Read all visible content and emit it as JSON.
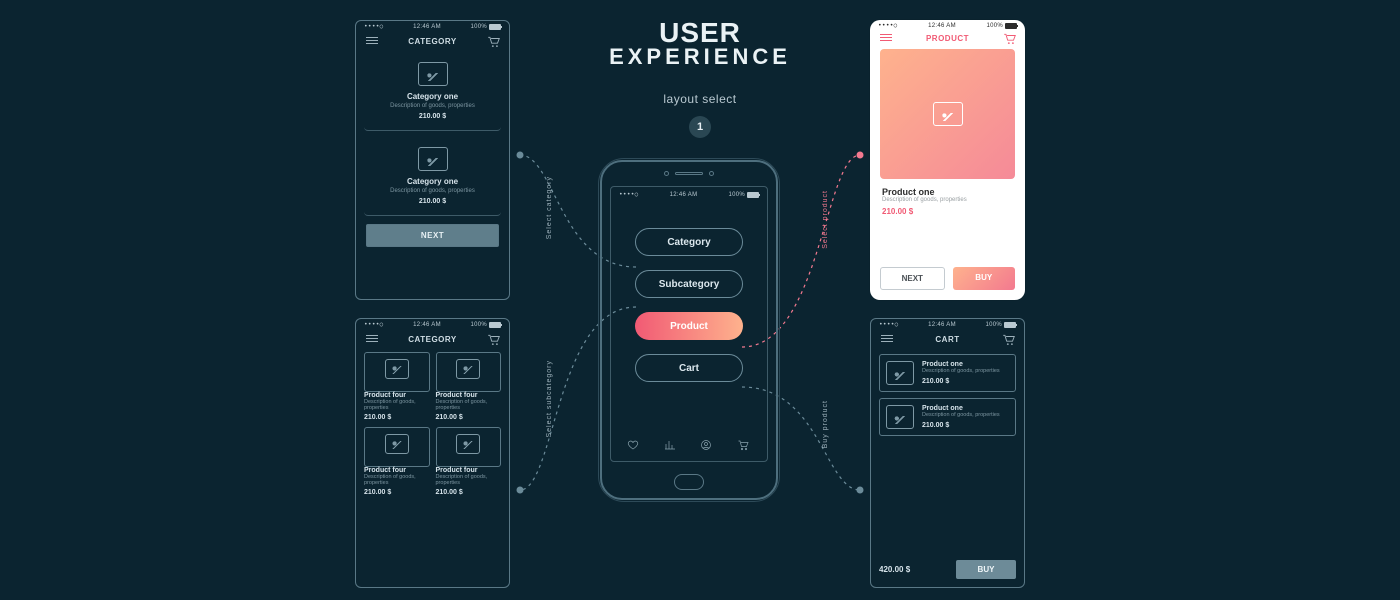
{
  "headline": {
    "l1": "USER",
    "l2": "EXPERIENCE"
  },
  "subtitle": "layout select",
  "step": "1",
  "status": {
    "signal": "••••○",
    "wifi": "⌔",
    "time": "12:46 AM",
    "battery": "100%"
  },
  "device": {
    "menu": [
      {
        "label": "Category",
        "active": false
      },
      {
        "label": "Subcategory",
        "active": false
      },
      {
        "label": "Product",
        "active": true
      },
      {
        "label": "Cart",
        "active": false
      }
    ]
  },
  "connectors": {
    "category": "Select category",
    "subcategory": "Select subcategory",
    "product": "Select product",
    "cart": "Buy product"
  },
  "screens": {
    "category": {
      "title": "CATEGORY",
      "items": [
        {
          "name": "Category one",
          "desc": "Description of goods, properties",
          "price": "210.00 $"
        },
        {
          "name": "Category one",
          "desc": "Description of goods, properties",
          "price": "210.00 $"
        }
      ],
      "next": "NEXT"
    },
    "subcategory": {
      "title": "CATEGORY",
      "items": [
        {
          "name": "Product four",
          "desc": "Description of goods, properties",
          "price": "210.00 $"
        },
        {
          "name": "Product four",
          "desc": "Description of goods, properties",
          "price": "210.00 $"
        },
        {
          "name": "Product four",
          "desc": "Description of goods, properties",
          "price": "210.00 $"
        },
        {
          "name": "Product four",
          "desc": "Description of goods, properties",
          "price": "210.00 $"
        }
      ]
    },
    "product": {
      "title": "PRODUCT",
      "name": "Product one",
      "desc": "Description of goods, properties",
      "price": "210.00 $",
      "next": "NEXT",
      "buy": "BUY"
    },
    "cart": {
      "title": "CART",
      "items": [
        {
          "name": "Product one",
          "desc": "Description of goods, properties",
          "price": "210.00 $"
        },
        {
          "name": "Product one",
          "desc": "Description of goods, properties",
          "price": "210.00 $"
        }
      ],
      "total": "420.00 $",
      "buy": "BUY"
    }
  }
}
